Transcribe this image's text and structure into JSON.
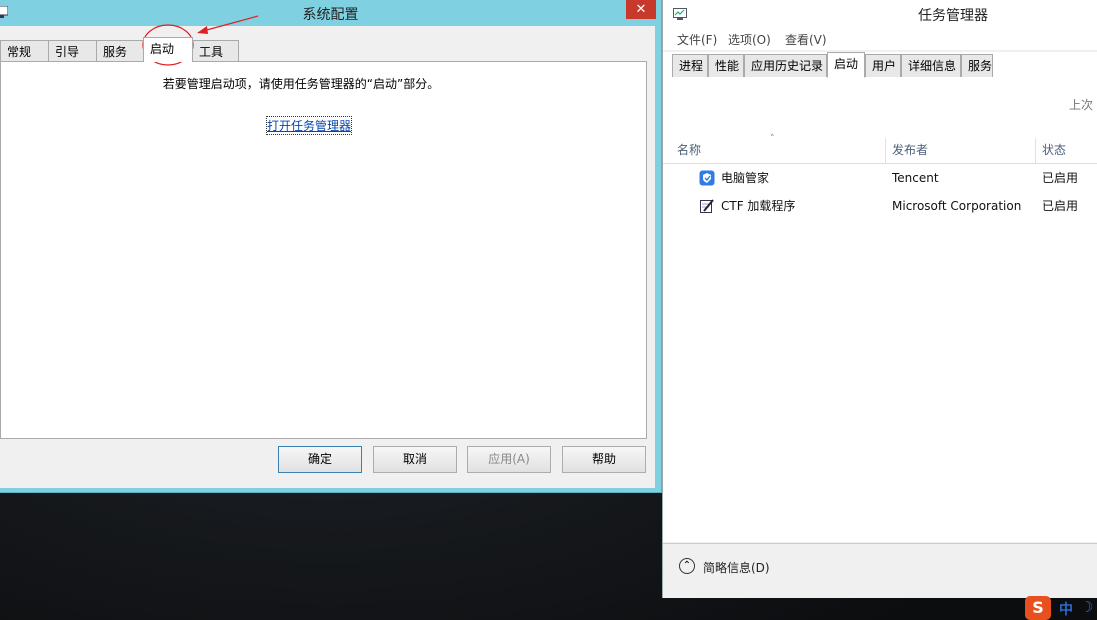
{
  "msconfig": {
    "title": "系统配置",
    "close_glyph": "✕",
    "tabs": [
      {
        "label": "常规"
      },
      {
        "label": "引导"
      },
      {
        "label": "服务"
      },
      {
        "label": "启动",
        "active": true
      },
      {
        "label": "工具"
      }
    ],
    "info_text": "若要管理启动项，请使用任务管理器的“启动”部分。",
    "link_text": "打开任务管理器",
    "buttons": {
      "ok": "确定",
      "cancel": "取消",
      "apply": "应用(A)",
      "help": "帮助"
    },
    "annotation_color": "#e02020"
  },
  "taskmgr": {
    "title": "任务管理器",
    "menu": [
      "文件(F)",
      "选项(O)",
      "查看(V)"
    ],
    "tabs": [
      {
        "label": "进程"
      },
      {
        "label": "性能"
      },
      {
        "label": "应用历史记录"
      },
      {
        "label": "启动",
        "active": true
      },
      {
        "label": "用户"
      },
      {
        "label": "详细信息"
      },
      {
        "label": "服务"
      }
    ],
    "last_bios_label": "上次",
    "sort_indicator": "˄",
    "columns": [
      "名称",
      "发布者",
      "状态"
    ],
    "rows": [
      {
        "name": "电脑管家",
        "publisher": "Tencent",
        "status": "已启用",
        "icon": "tencent-shield-icon"
      },
      {
        "name": "CTF 加载程序",
        "publisher": "Microsoft Corporation",
        "status": "已启用",
        "icon": "ctf-pen-icon"
      }
    ],
    "fewer_details": "简略信息(D)",
    "chevron_glyph": "⌃"
  },
  "tray": {
    "sogou_glyph": "S",
    "ime_mode": "中",
    "moon_glyph": "☽"
  }
}
